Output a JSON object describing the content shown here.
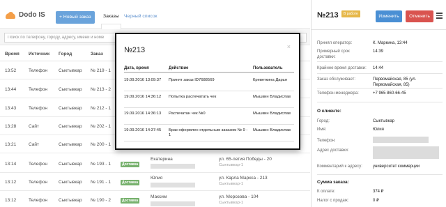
{
  "app": {
    "logo_text": "Dodo IS",
    "new_order_label": "+ Новый заказ",
    "tab_orders": "Заказы",
    "tab_blacklist": "Черный список"
  },
  "search": {
    "placeholder": "Поиск по телефону, городу, адресу, имени и номе"
  },
  "table": {
    "headers": [
      "Время",
      "Источник",
      "Город",
      "Заказ"
    ],
    "rows": [
      {
        "time": "13:52",
        "source": "Телефон",
        "city": "Сыктывкар",
        "order": "№ 219 - 1"
      },
      {
        "time": "13:44",
        "source": "Телефон",
        "city": "Сыктывкар",
        "order": "№ 213 - 2"
      },
      {
        "time": "13:43",
        "source": "Телефон",
        "city": "Сыктывкар",
        "order": "№ 212 - 1"
      },
      {
        "time": "13:28",
        "source": "Сайт",
        "city": "Сыктывкар",
        "order": "№ 202 - 1"
      },
      {
        "time": "13:21",
        "source": "Сайт",
        "city": "Сыктывкар",
        "order": "№ 200 - 1"
      },
      {
        "time": "13:14",
        "source": "Телефон",
        "city": "Сыктывкар",
        "order": "№ 193 - 1",
        "badge": "Доставка",
        "name": "Екатерина",
        "address": "ул. 65-летия Победы - 20",
        "address_city": "Сыктывкар-1"
      },
      {
        "time": "13:12",
        "source": "Телефон",
        "city": "Сыктывкар",
        "order": "№ 191 - 1",
        "badge": "Доставка",
        "name": "Юлия",
        "address": "ул. Карла Маркса - 213",
        "address_city": "Сыктывкар-1"
      },
      {
        "time": "13:12",
        "source": "Телефон",
        "city": "Сыктывкар",
        "order": "№ 190 - 2",
        "badge": "Доставка",
        "name": "Максим",
        "address": "ул. Морозова - 104",
        "address_city": "Сыктывкар-1"
      }
    ]
  },
  "modal": {
    "title": "№213",
    "close": "×",
    "headers": {
      "date": "Дата, время",
      "action": "Действие",
      "user": "Пользователь"
    },
    "rows": [
      {
        "date": "19.09.2016 13:09:37",
        "action": "Принят заказ ID7688569",
        "user": "Креветкина Дарья"
      },
      {
        "date": "19.09.2016 14:36:12",
        "action": "Попытка распечатать чек",
        "user": "Мышкин Владислав"
      },
      {
        "date": "19.09.2016 14:36:13",
        "action": "Распечатан чек №0",
        "user": "Мышкин Владислав"
      },
      {
        "date": "19.09.2016 14:37:45",
        "action": "Брак оформлен отдельным заказом № 9 - 1",
        "user": "Мышкин Владислав"
      }
    ]
  },
  "panel": {
    "title": "№213",
    "status": "В работе",
    "edit_label": "Изменить",
    "cancel_label": "Отменить",
    "fields": [
      {
        "label": "Принял оператор:",
        "value": "К. Маркина, 13:44"
      },
      {
        "label": "Примерный срок доставки:",
        "value": "14:39"
      },
      {
        "label": "Крайнее время доставки:",
        "value": "14:44"
      },
      {
        "label": "Заказ обслуживает:",
        "value": "Первомайская, 85 (ул. Первомайская, 85)"
      },
      {
        "label": "Телефон менеджера:",
        "value": "+7 965 860-66-45"
      }
    ],
    "client_section": "О клиенте:",
    "client_fields": [
      {
        "label": "Город:",
        "value": "Сыктывкар"
      },
      {
        "label": "Имя:",
        "value": "Юлия"
      },
      {
        "label": "Телефон:",
        "value": ""
      },
      {
        "label": "Адрес доставки:",
        "value": ""
      },
      {
        "label": "Комментарий к адресу:",
        "value": "университет коммерции"
      }
    ],
    "sum_section": "Сумма заказа:",
    "sum_fields": [
      {
        "label": "К оплате:",
        "value": "374 ₽"
      },
      {
        "label": "Налог с продаж:",
        "value": "0 ₽"
      }
    ]
  },
  "colors": {
    "primary": "#4a8fd4",
    "danger": "#d9534f",
    "status": "#e6b84a",
    "delivery_badge": "#5aa04e",
    "logo": "#f28a22"
  }
}
